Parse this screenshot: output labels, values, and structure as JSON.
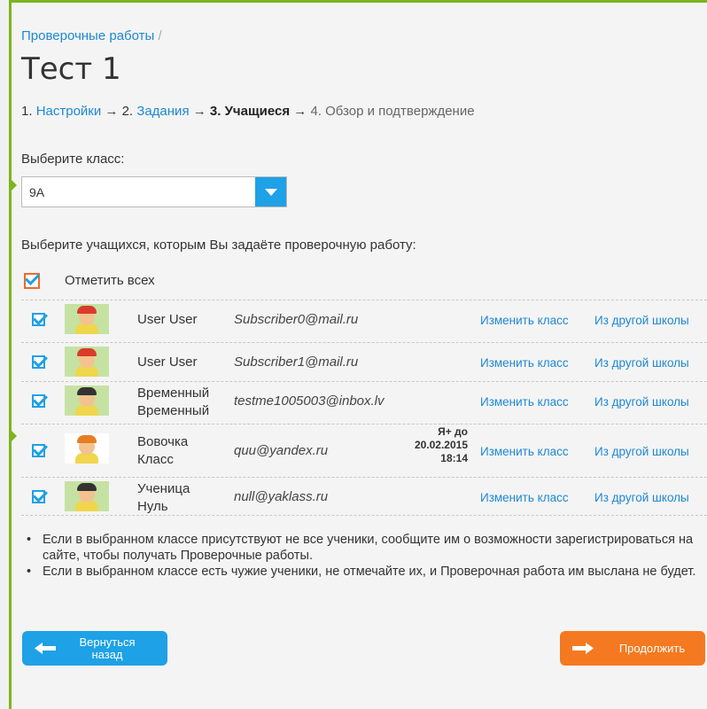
{
  "breadcrumb": {
    "link": "Проверочные работы",
    "sep": "/"
  },
  "title": "Тест 1",
  "steps": {
    "s1_num": "1.",
    "s1_label": "Настройки",
    "arrow1": "→",
    "s2_num": "2.",
    "s2_label": "Задания",
    "arrow2": "→",
    "s3_label": "3. Учащиеся",
    "arrow3": "→",
    "s4_label": "4. Обзор и подтверждение"
  },
  "class_select": {
    "label": "Выберите класс:",
    "value": "9A"
  },
  "students_label": "Выберите учащихся, которым Вы задаёте проверочную работу:",
  "select_all": {
    "label": "Отметить всех",
    "checked": true
  },
  "students": [
    {
      "name_line1": "User User",
      "name_line2": "",
      "email": "Subscriber0@mail.ru",
      "status_line1": "",
      "status_line2": "",
      "status_line3": "",
      "change_class": "Изменить класс",
      "other_school": "Из другой школы",
      "checked": true
    },
    {
      "name_line1": "User User",
      "name_line2": "",
      "email": "Subscriber1@mail.ru",
      "status_line1": "",
      "status_line2": "",
      "status_line3": "",
      "change_class": "Изменить класс",
      "other_school": "Из другой школы",
      "checked": true
    },
    {
      "name_line1": "Временный",
      "name_line2": "Временный",
      "email": "testme1005003@inbox.lv",
      "status_line1": "",
      "status_line2": "",
      "status_line3": "",
      "change_class": "Изменить класс",
      "other_school": "Из другой школы",
      "checked": true
    },
    {
      "name_line1": "Вовочка",
      "name_line2": "Класс",
      "email": "quu@yandex.ru",
      "status_line1": "Я+ до",
      "status_line2": "20.02.2015",
      "status_line3": "18:14",
      "change_class": "Изменить класс",
      "other_school": "Из другой школы",
      "checked": true
    },
    {
      "name_line1": "Ученица",
      "name_line2": "Нуль",
      "email": "null@yaklass.ru",
      "status_line1": "",
      "status_line2": "",
      "status_line3": "",
      "change_class": "Изменить класс",
      "other_school": "Из другой школы",
      "checked": true
    }
  ],
  "notes": [
    "Если в выбранном классе присутствуют не все ученики, сообщите им о возможности зарегистрироваться на сайте, чтобы получать Проверочные работы.",
    "Если в выбранном классе есть чужие ученики, не отмечайте их, и Проверочная работа им выслана не будет."
  ],
  "buttons": {
    "back_line1": "Вернуться",
    "back_line2": "назад",
    "continue": "Продолжить"
  },
  "colors": {
    "accent_blue": "#1ea1e6",
    "accent_orange": "#f47920",
    "frame_green": "#7ab51d"
  }
}
